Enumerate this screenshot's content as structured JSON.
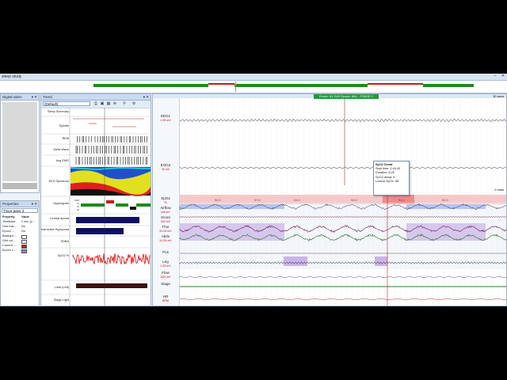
{
  "window": {
    "title": "sleep study"
  },
  "left_panel": {
    "title": "Digital video",
    "ctl": "▾ ✕"
  },
  "properties": {
    "title": "Properties",
    "selector": "Trace pane 2",
    "header": {
      "prop": "Property",
      "value": "Value"
    },
    "rows": [
      {
        "k": "Timebase",
        "v": "2 min (p..."
      },
      {
        "k": "Grid mar...",
        "v": "No"
      },
      {
        "k": "Epoch ...",
        "v": "No"
      },
      {
        "k": "Backgro...",
        "v": ""
      },
      {
        "k": "Grid col...",
        "v": ""
      },
      {
        "k": "Current ...",
        "v": ""
      },
      {
        "k": "Epoch c...",
        "v": ""
      }
    ]
  },
  "trend": {
    "title": "Trend",
    "combo": "(Default)",
    "labels": [
      "Sleep Summary",
      "Spindle",
      "REM",
      "Delta Wave",
      "Avg EMG",
      "EEG Spectrum",
      "Hypnogram",
      "Central Apnea",
      "Obstructive Hypopnea",
      "SDBA",
      "SpO2 %",
      "Limb (Left)",
      "Stage Light"
    ],
    "hyp_labels": [
      "REM",
      "S1",
      "S2",
      "S3"
    ]
  },
  "signals": {
    "event_title": "Event: N1 R42  Epoch: 684 - STAGE 2",
    "timebase_right": "30 secs",
    "timebase_right2": "2 mins",
    "channels": [
      {
        "name": "EEG1",
        "unit": "1.25 mV"
      },
      {
        "name": "EOG2",
        "unit": "40 mV"
      },
      {
        "name": "SpO2",
        "unit": "%"
      },
      {
        "name": "Airflow",
        "unit": "refl mV"
      },
      {
        "name": "Snore",
        "unit": "200 mV"
      },
      {
        "name": "Thor",
        "unit": "31.25 mV"
      },
      {
        "name": "Abdo",
        "unit": "31.25 mV"
      },
      {
        "name": "Pos",
        "unit": ""
      },
      {
        "name": "Leg",
        "unit": "1.25 mV"
      },
      {
        "name": "Flow",
        "unit": "500 mV"
      },
      {
        "name": "Stage",
        "unit": ""
      },
      {
        "name": "HR",
        "unit": "BPM"
      }
    ],
    "spo2_values": [
      "94.0",
      "97.0",
      "94.0",
      "94.0",
      "94.0",
      "94.0"
    ],
    "tooltip": {
      "title": "SpO2 Desat",
      "lines": [
        "Start time: 2:16:45",
        "Duration: 8.25",
        "SpO2 desat: 6",
        "Lowest SpO2: 88"
      ]
    }
  },
  "colors": {
    "accent": "#1e8b1e",
    "event_red": "#c02020",
    "pane_header": "#c9daf0"
  }
}
